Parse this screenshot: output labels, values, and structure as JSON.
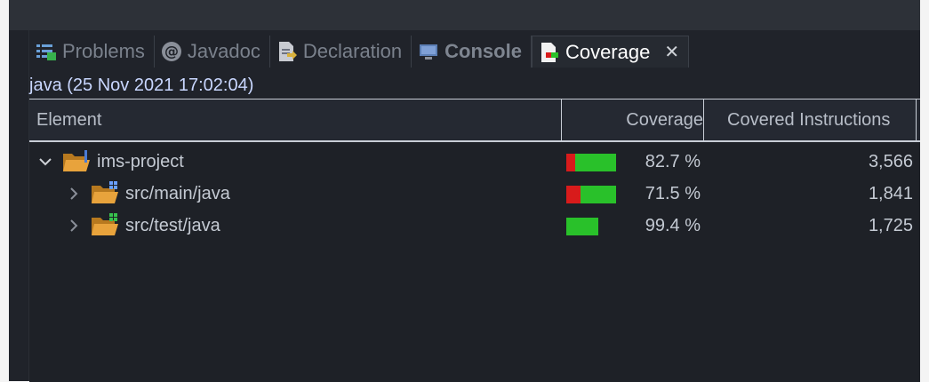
{
  "tabs": [
    {
      "label": "Problems",
      "icon": "problems-icon"
    },
    {
      "label": "Javadoc",
      "icon": "javadoc-icon"
    },
    {
      "label": "Declaration",
      "icon": "declaration-icon"
    },
    {
      "label": "Console",
      "icon": "console-icon"
    },
    {
      "label": "Coverage",
      "icon": "coverage-icon",
      "active": true,
      "close_label": "✕"
    }
  ],
  "session": {
    "label": "java (25 Nov 2021 17:02:04)"
  },
  "table": {
    "headers": {
      "element": "Element",
      "coverage": "Coverage",
      "covered_instructions": "Covered Instructions"
    },
    "rows": [
      {
        "name": "ims-project",
        "coverage": "82.7 %",
        "covered": "3,566",
        "coverage_value": 82.7,
        "expanded": true
      },
      {
        "name": "src/main/java",
        "coverage": "71.5 %",
        "covered": "1,841",
        "coverage_value": 71.5,
        "expanded": false
      },
      {
        "name": "src/test/java",
        "coverage": "99.4 %",
        "covered": "1,725",
        "coverage_value": 99.4,
        "expanded": false
      }
    ]
  },
  "colors": {
    "covered": "#29c12a",
    "missed": "#d81b1b",
    "folder": "#e8a33c",
    "session_text": "#c9d7ff"
  }
}
